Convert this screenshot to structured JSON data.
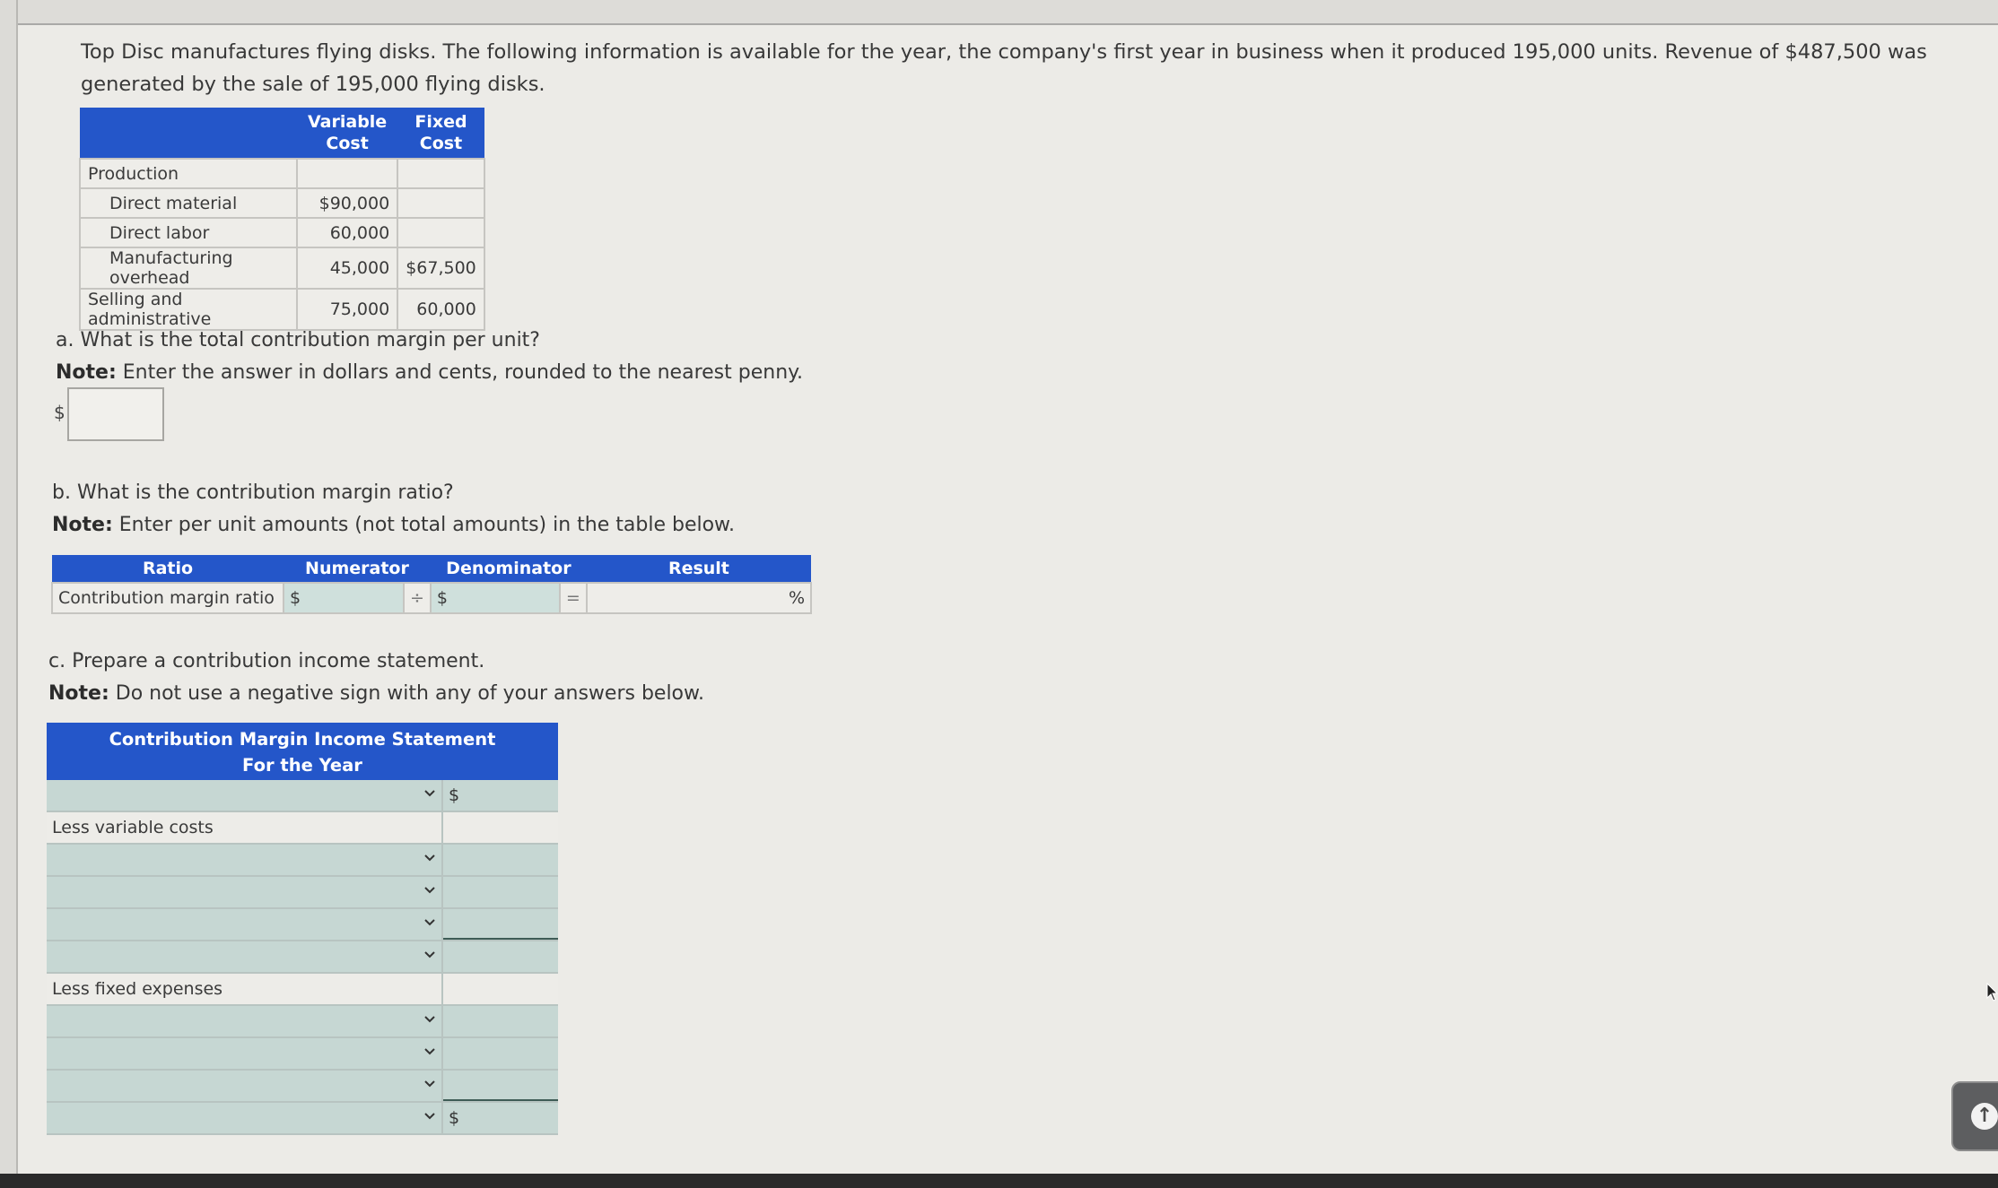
{
  "intro": "Top Disc manufactures flying disks. The following information is available for the year, the company's first year in business when it produced 195,000 units. Revenue of $487,500 was generated by the sale of 195,000 flying disks.",
  "cost_table": {
    "headers": [
      "",
      "Variable Cost",
      "Fixed Cost"
    ],
    "rows": [
      {
        "label": "Production",
        "variable": "",
        "fixed": "",
        "indent": false
      },
      {
        "label": "Direct material",
        "variable": "$90,000",
        "fixed": "",
        "indent": true
      },
      {
        "label": "Direct labor",
        "variable": "60,000",
        "fixed": "",
        "indent": true
      },
      {
        "label": "Manufacturing overhead",
        "variable": "45,000",
        "fixed": "$67,500",
        "indent": true
      },
      {
        "label": "Selling and administrative",
        "variable": "75,000",
        "fixed": "60,000",
        "indent": false
      }
    ]
  },
  "question_a": {
    "prompt": "a. What is the total contribution margin per unit?",
    "note_label": "Note:",
    "note_text": " Enter the answer in dollars and cents, rounded to the nearest penny.",
    "currency": "$",
    "answer_value": ""
  },
  "question_b": {
    "prompt": "b. What is the contribution margin ratio?",
    "note_label": "Note:",
    "note_text": " Enter per unit amounts (not total amounts) in the table below.",
    "headers": [
      "Ratio",
      "Numerator",
      "Denominator",
      "Result"
    ],
    "row": {
      "label": "Contribution margin ratio",
      "numerator_currency": "$",
      "numerator_value": "",
      "divide": "÷",
      "denominator_currency": "$",
      "denominator_value": "",
      "equals": "=",
      "result_value": "",
      "result_unit": "%"
    }
  },
  "question_c": {
    "prompt": "c. Prepare a contribution income statement.",
    "note_label": "Note:",
    "note_text": " Do not use a negative sign with any of your answers below.",
    "title_line1": "Contribution Margin Income Statement",
    "title_line2": "For the Year",
    "rows": [
      {
        "type": "select",
        "label": "",
        "currency": "$",
        "value": ""
      },
      {
        "type": "label",
        "label": "Less variable costs"
      },
      {
        "type": "select",
        "label": "",
        "currency": "",
        "value": ""
      },
      {
        "type": "select",
        "label": "",
        "currency": "",
        "value": ""
      },
      {
        "type": "select",
        "label": "",
        "currency": "",
        "value": ""
      },
      {
        "type": "select",
        "label": "",
        "currency": "",
        "value": ""
      },
      {
        "type": "label",
        "label": "Less fixed expenses"
      },
      {
        "type": "select",
        "label": "",
        "currency": "",
        "value": ""
      },
      {
        "type": "select",
        "label": "",
        "currency": "",
        "value": ""
      },
      {
        "type": "select",
        "label": "",
        "currency": "",
        "value": ""
      },
      {
        "type": "select",
        "label": "",
        "currency": "$",
        "value": ""
      }
    ]
  },
  "icons": {
    "chevron": "⌄",
    "scroll_top": "↑"
  },
  "colors": {
    "header_blue": "#2456c9",
    "input_green": "#c6d7d3"
  }
}
